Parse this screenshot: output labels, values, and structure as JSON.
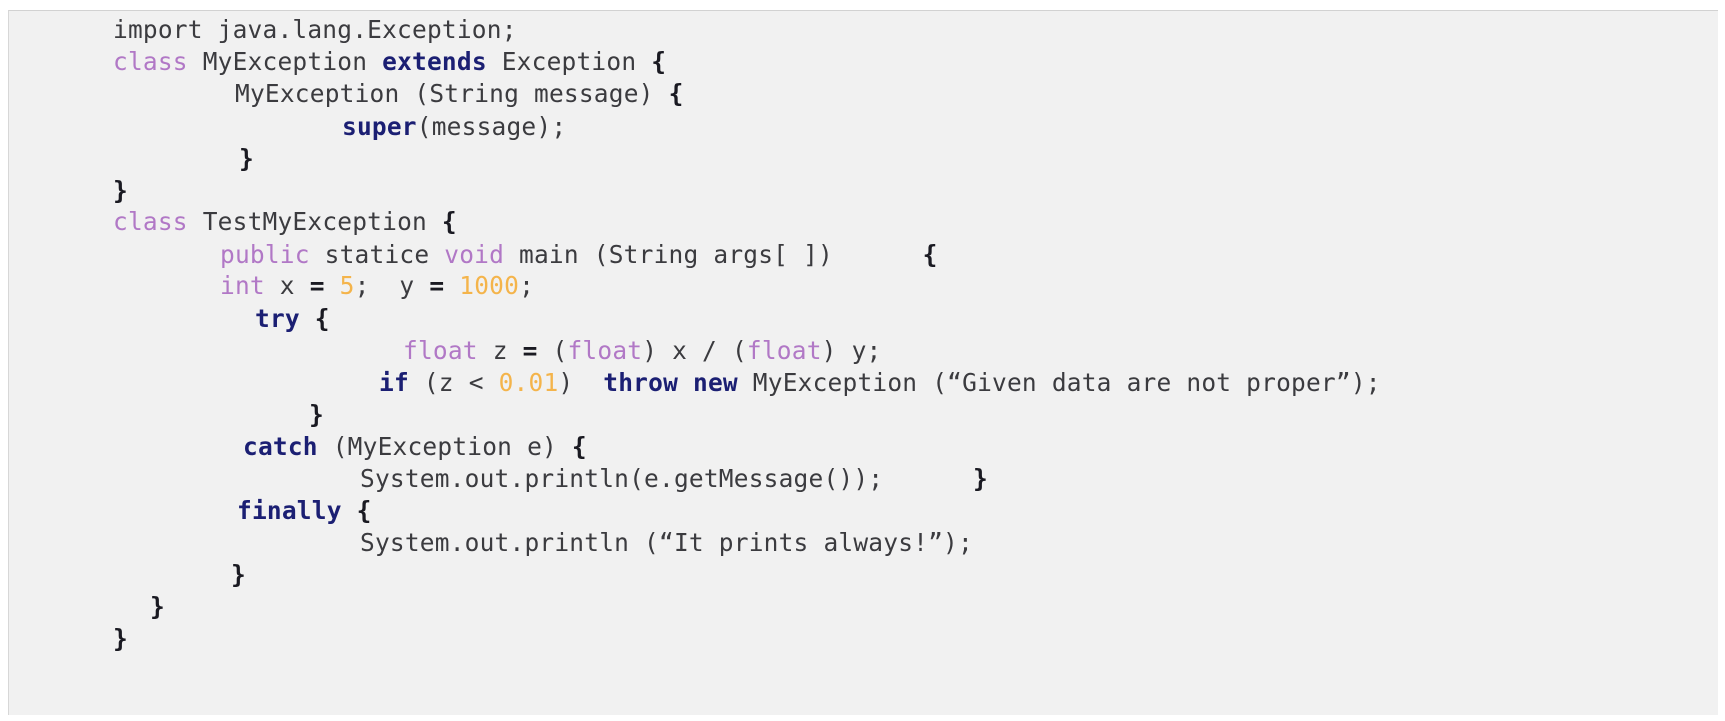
{
  "code": {
    "lines": [
      {
        "tokens": [
          {
            "text": "import java.lang.Exception;",
            "kind": "plain"
          }
        ]
      },
      {
        "tokens": [
          {
            "text": "class",
            "kind": "kw"
          },
          {
            "text": " MyException ",
            "kind": "plain"
          },
          {
            "text": "extends",
            "kind": "bold"
          },
          {
            "text": " Exception ",
            "kind": "plain"
          },
          {
            "text": "{",
            "kind": "punct"
          }
        ]
      },
      {
        "tokens": [
          {
            "text": "MyException (String message) ",
            "kind": "plain"
          },
          {
            "text": "{",
            "kind": "punct"
          }
        ]
      },
      {
        "tokens": [
          {
            "text": "super",
            "kind": "bold"
          },
          {
            "text": "(message);",
            "kind": "plain"
          }
        ]
      },
      {
        "tokens": [
          {
            "text": "}",
            "kind": "punct"
          }
        ]
      },
      {
        "tokens": [
          {
            "text": "}",
            "kind": "punct"
          }
        ]
      },
      {
        "tokens": [
          {
            "text": "class",
            "kind": "kw"
          },
          {
            "text": " TestMyException ",
            "kind": "plain"
          },
          {
            "text": "{",
            "kind": "punct"
          }
        ]
      },
      {
        "tokens": [
          {
            "text": "public",
            "kind": "kw"
          },
          {
            "text": " statice ",
            "kind": "plain"
          },
          {
            "text": "void",
            "kind": "kw"
          },
          {
            "text": " main (String args[ ])",
            "kind": "plain"
          },
          {
            "text": "      {",
            "kind": "punct"
          }
        ]
      },
      {
        "tokens": [
          {
            "text": "int",
            "kind": "kw"
          },
          {
            "text": " x ",
            "kind": "plain"
          },
          {
            "text": "=",
            "kind": "punct"
          },
          {
            "text": " ",
            "kind": "plain"
          },
          {
            "text": "5",
            "kind": "num"
          },
          {
            "text": ";  y ",
            "kind": "plain"
          },
          {
            "text": "=",
            "kind": "punct"
          },
          {
            "text": " ",
            "kind": "plain"
          },
          {
            "text": "1000",
            "kind": "num"
          },
          {
            "text": ";",
            "kind": "plain"
          }
        ]
      },
      {
        "tokens": [
          {
            "text": "try",
            "kind": "bold"
          },
          {
            "text": " {",
            "kind": "punct"
          }
        ]
      },
      {
        "tokens": [
          {
            "text": "float",
            "kind": "kw"
          },
          {
            "text": " z ",
            "kind": "plain"
          },
          {
            "text": "=",
            "kind": "punct"
          },
          {
            "text": " (",
            "kind": "plain"
          },
          {
            "text": "float",
            "kind": "kw"
          },
          {
            "text": ") x / (",
            "kind": "plain"
          },
          {
            "text": "float",
            "kind": "kw"
          },
          {
            "text": ") y;",
            "kind": "plain"
          }
        ]
      },
      {
        "tokens": [
          {
            "text": "if",
            "kind": "bold"
          },
          {
            "text": " (z < ",
            "kind": "plain"
          },
          {
            "text": "0.01",
            "kind": "num"
          },
          {
            "text": ")  ",
            "kind": "plain"
          },
          {
            "text": "throw",
            "kind": "bold"
          },
          {
            "text": " ",
            "kind": "plain"
          },
          {
            "text": "new",
            "kind": "bold"
          },
          {
            "text": " MyException (“Given data are not proper”);",
            "kind": "plain"
          }
        ]
      },
      {
        "tokens": [
          {
            "text": "}",
            "kind": "punct"
          }
        ]
      },
      {
        "tokens": [
          {
            "text": "catch",
            "kind": "bold"
          },
          {
            "text": " (MyException e) ",
            "kind": "plain"
          },
          {
            "text": "{",
            "kind": "punct"
          }
        ]
      },
      {
        "tokens": [
          {
            "text": "System.out.println(e.getMessage());",
            "kind": "plain"
          },
          {
            "text": "      }",
            "kind": "punct"
          }
        ]
      },
      {
        "tokens": [
          {
            "text": "finally",
            "kind": "bold"
          },
          {
            "text": " {",
            "kind": "punct"
          }
        ]
      },
      {
        "tokens": [
          {
            "text": "System.out.println (“It prints always!”);",
            "kind": "plain"
          }
        ]
      },
      {
        "tokens": [
          {
            "text": "}",
            "kind": "punct"
          }
        ]
      },
      {
        "tokens": [
          {
            "text": "}",
            "kind": "punct"
          }
        ]
      },
      {
        "tokens": [
          {
            "text": "}",
            "kind": "punct"
          }
        ]
      }
    ]
  },
  "colors": {
    "background": "#f1f1f1",
    "plain_text": "#3b3b3f",
    "keyword_purple": "#b178c6",
    "keyword_bold_blue": "#1b1f73",
    "number_orange": "#f4b44b"
  }
}
